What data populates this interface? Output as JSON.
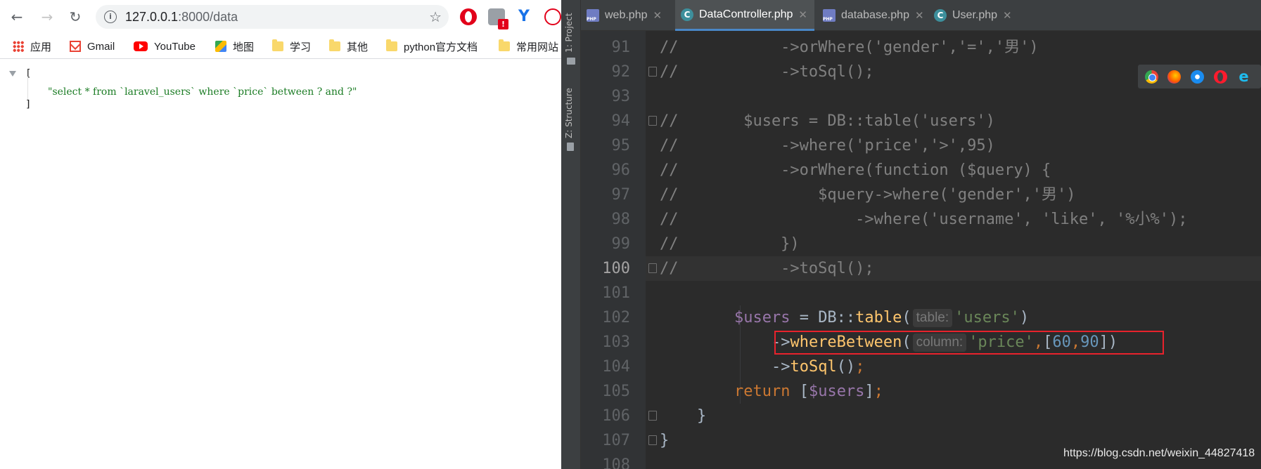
{
  "browser": {
    "url_host": "127.0.0.1",
    "url_rest": ":8000/data",
    "bookmarks": [
      {
        "label": "应用",
        "icon": "apps-grid-icon"
      },
      {
        "label": "Gmail",
        "icon": "gmail-icon"
      },
      {
        "label": "YouTube",
        "icon": "youtube-icon"
      },
      {
        "label": "地图",
        "icon": "maps-icon"
      },
      {
        "label": "学习",
        "icon": "folder-icon"
      },
      {
        "label": "其他",
        "icon": "folder-icon"
      },
      {
        "label": "python官方文档",
        "icon": "folder-icon"
      },
      {
        "label": "常用网站",
        "icon": "folder-icon"
      }
    ],
    "json_output": {
      "open": "[",
      "value": "\"select * from `laravel_users` where `price` between ? and ?\"",
      "close": "]"
    }
  },
  "ide": {
    "side_tabs": {
      "project": "1: Project",
      "structure": "Z: Structure"
    },
    "tabs": [
      {
        "label": "web.php",
        "type": "php",
        "active": false
      },
      {
        "label": "DataController.php",
        "type": "class",
        "active": true
      },
      {
        "label": "database.php",
        "type": "php",
        "active": false
      },
      {
        "label": "User.php",
        "type": "class",
        "active": false
      }
    ],
    "line_numbers": [
      "91",
      "92",
      "93",
      "94",
      "95",
      "96",
      "97",
      "98",
      "99",
      "100",
      "101",
      "102",
      "103",
      "104",
      "105",
      "106",
      "107",
      "108"
    ],
    "current_line": "100",
    "param_hints": {
      "table": "table:",
      "column": "column:"
    },
    "colors": {
      "keyword": "#cc7832",
      "variable": "#9876aa",
      "string": "#6a8759",
      "number": "#6897bb",
      "method": "#ffc66d",
      "highlight_box": "#e8222c"
    }
  },
  "watermark": "https://blog.csdn.net/weixin_44827418"
}
